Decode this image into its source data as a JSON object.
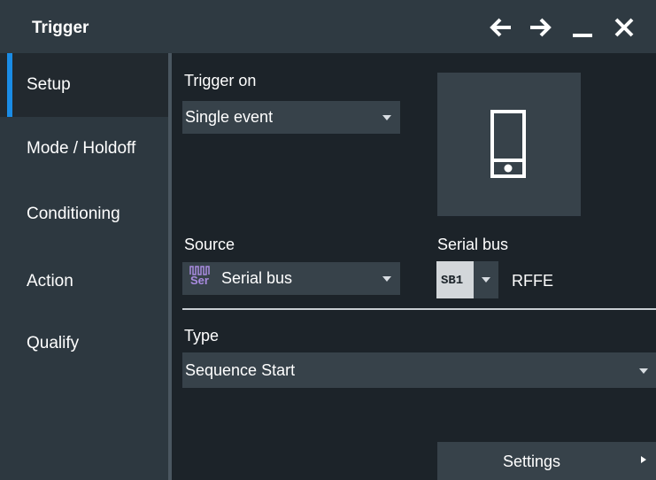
{
  "window": {
    "title": "Trigger",
    "controls": [
      "back-icon",
      "forward-icon",
      "minimize-icon",
      "close-icon"
    ]
  },
  "sidebar": {
    "items": [
      {
        "label": "Setup",
        "active": true
      },
      {
        "label": "Mode / Holdoff",
        "active": false
      },
      {
        "label": "Conditioning",
        "active": false
      },
      {
        "label": "Action",
        "active": false
      },
      {
        "label": "Qualify",
        "active": false
      }
    ]
  },
  "setup": {
    "trigger_on_label": "Trigger on",
    "trigger_on_value": "Single event",
    "source_label": "Source",
    "source_value": "Serial bus",
    "source_icon_text": "Ser",
    "serial_bus_label": "Serial bus",
    "serial_bus_id": "SB1",
    "serial_bus_protocol": "RFFE",
    "type_label": "Type",
    "type_value": "Sequence Start",
    "settings_button": "Settings"
  },
  "colors": {
    "background": "#1c2329",
    "titlebar": "#2f3a42",
    "sidebar": "#2d3840",
    "accent": "#1a8ce6",
    "field": "#37424a",
    "serial_icon": "#a98be0"
  }
}
